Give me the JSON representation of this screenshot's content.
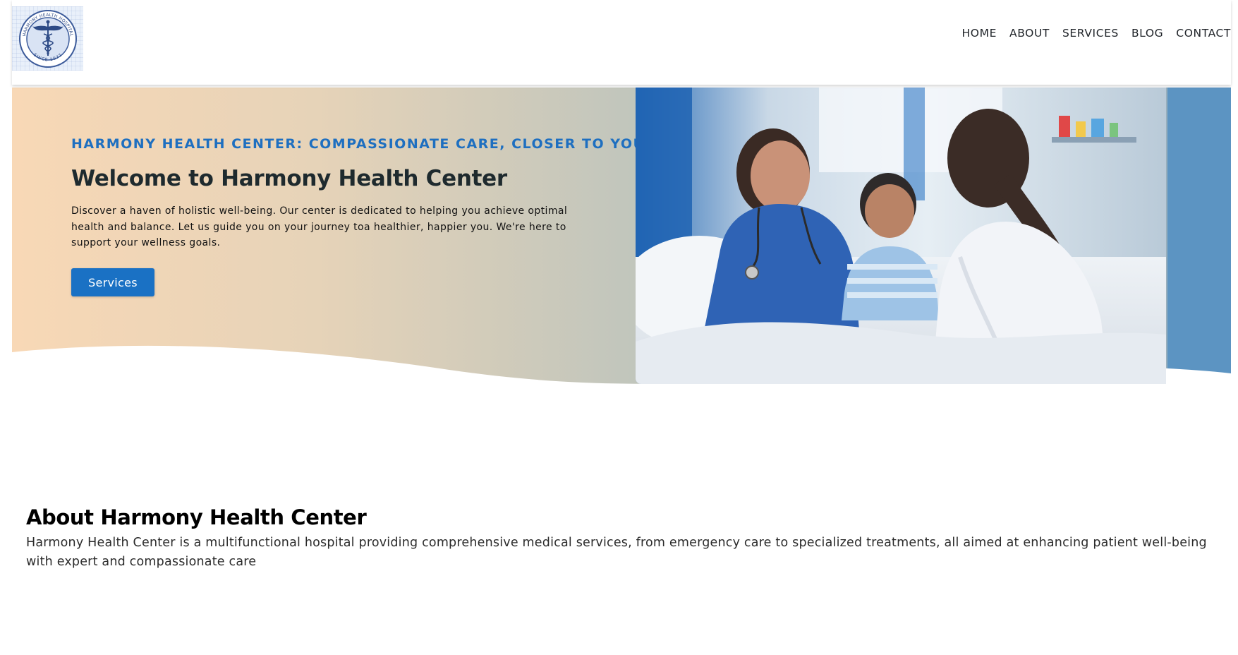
{
  "brand": {
    "logo_icon": "caduceus-seal-logo",
    "logo_text_top": "HARMONY HEALTH HOSPITAL",
    "logo_text_bottom": "SINCE 1977"
  },
  "nav": {
    "items": [
      {
        "label": "HOME"
      },
      {
        "label": "ABOUT"
      },
      {
        "label": "SERVICES"
      },
      {
        "label": "BLOG"
      },
      {
        "label": "CONTACT"
      }
    ]
  },
  "hero": {
    "tagline": "HARMONY HEALTH CENTER: COMPASSIONATE CARE, CLOSER TO YOU.",
    "title": "Welcome to Harmony Health Center",
    "description": "Discover a haven of holistic well-being. Our center is dedicated to helping you achieve optimal health and balance. Let us guide you on your journey toa healthier, happier you. We're here to support your wellness goals.",
    "button_label": "Services",
    "image_icon": "doctor-with-child-patient-photo"
  },
  "about": {
    "title": "About Harmony Health Center",
    "text": "Harmony Health Center is a multifunctional hospital providing comprehensive medical services, from emergency care to specialized treatments, all aimed at enhancing patient well-being with expert and compassionate care"
  },
  "colors": {
    "accent": "#1a71c4",
    "tagline": "#1e6fc0",
    "hero_gradient_start": "#f8d8b6",
    "hero_gradient_end": "#95adbd",
    "hero_side_band": "#5c94c2"
  }
}
